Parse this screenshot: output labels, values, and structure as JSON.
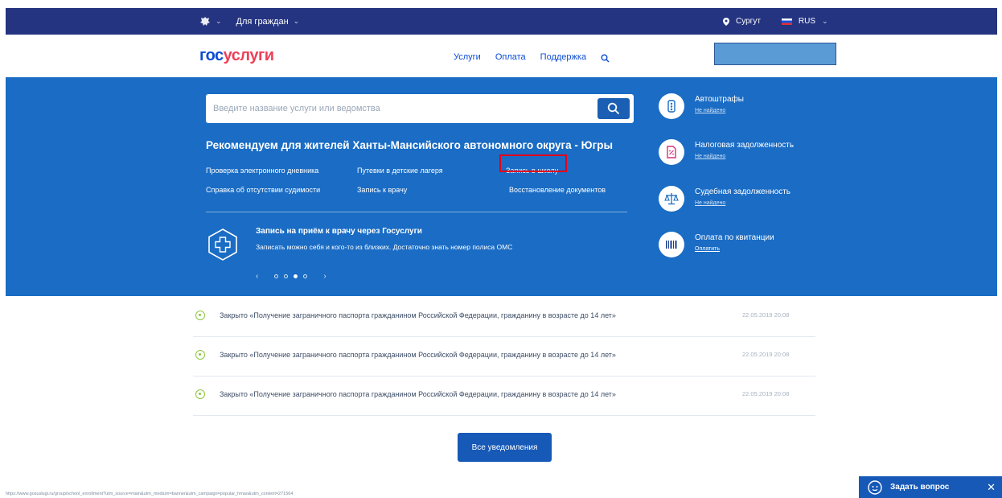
{
  "topbar": {
    "section_label": "Для граждан",
    "city": "Сургут",
    "language": "RUS"
  },
  "header": {
    "logo_part1": "гос",
    "logo_part2": "услуги",
    "nav": [
      "Услуги",
      "Оплата",
      "Поддержка"
    ]
  },
  "search": {
    "placeholder": "Введите название услуги или ведомства"
  },
  "recommendations": {
    "title": "Рекомендуем для жителей Ханты-Мансийского автономного округа - Югры",
    "links": [
      "Проверка электронного дневника",
      "Путевки в детские лагеря",
      "Запись в школу",
      "Справка об отсутствии судимости",
      "Запись к врачу",
      "Восстановление документов"
    ]
  },
  "promo": {
    "title": "Запись на приём к врачу через Госуслуги",
    "text": "Записать можно себя и кого-то из близких. Достаточно знать номер полиса ОМС",
    "active_slide": 3,
    "slide_count": 4
  },
  "side": [
    {
      "title": "Автоштрафы",
      "status": "Не найдено",
      "icon": "car-fines-icon"
    },
    {
      "title": "Налоговая задолженность",
      "status": "Не найдено",
      "icon": "tax-icon"
    },
    {
      "title": "Судебная задолженность",
      "status": "Не найдено",
      "icon": "scales-icon"
    },
    {
      "title": "Оплата по квитанции",
      "status": "Оплатить",
      "icon": "barcode-icon"
    }
  ],
  "notifications": [
    {
      "text": "Закрыто «Получение заграничного паспорта гражданином Российской Федерации, гражданину в возрасте до 14 лет»",
      "date": "22.05.2019 20:08"
    },
    {
      "text": "Закрыто «Получение заграничного паспорта гражданином Российской Федерации, гражданину в возрасте до 14 лет»",
      "date": "22.05.2019 20:08"
    },
    {
      "text": "Закрыто «Получение заграничного паспорта гражданином Российской Федерации, гражданину в возрасте до 14 лет»",
      "date": "22.05.2019 20:08"
    }
  ],
  "all_notifications_button": "Все уведомления",
  "status_url": "https://www.gosuslugi.ru/group/school_enrollment?utm_source=main&utm_medium=banner&utm_campaign=popular_hmao&utm_content=271564",
  "ask_button": "Задать вопрос",
  "colors": {
    "topbar": "#243480",
    "band": "#1a6cc4",
    "accent": "#0d4cd3",
    "highlight": "#e3001b"
  }
}
